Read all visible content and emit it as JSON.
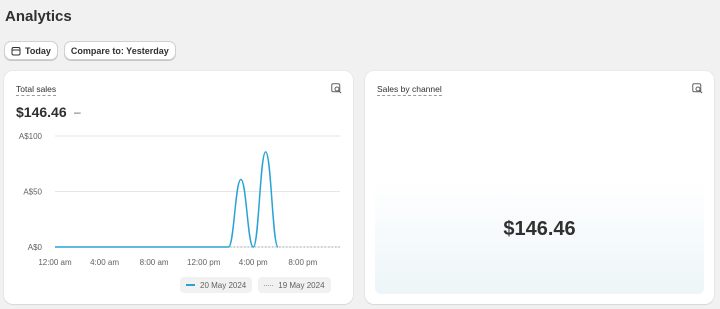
{
  "page": {
    "title": "Analytics"
  },
  "toolbar": {
    "date_button_label": "Today",
    "compare_button_label": "Compare to: Yesterday"
  },
  "total_sales_card": {
    "title": "Total sales",
    "value": "$146.46",
    "delta": "–",
    "legend": [
      "20 May 2024",
      "19 May 2024"
    ]
  },
  "sales_by_channel_card": {
    "title": "Sales by channel",
    "value": "$146.46"
  },
  "colors": {
    "current_series": "#29a3d4",
    "previous_series": "#9aa8b2"
  },
  "chart_data": {
    "type": "line",
    "title": "Total sales",
    "y_ticks": [
      "A$0",
      "A$50",
      "A$100"
    ],
    "y_tick_values": [
      0,
      50,
      100
    ],
    "ylim": [
      0,
      100
    ],
    "x_tick_labels": [
      "12:00 am",
      "4:00 am",
      "8:00 am",
      "12:00 pm",
      "4:00 pm",
      "8:00 pm"
    ],
    "xlim": [
      0,
      23
    ],
    "grid": true,
    "series": [
      {
        "name": "20 May 2024",
        "style": "solid",
        "x": [
          0,
          1,
          2,
          3,
          4,
          5,
          6,
          7,
          8,
          9,
          10,
          11,
          12,
          13,
          14,
          15,
          16,
          17,
          18,
          19,
          20,
          21,
          22,
          23
        ],
        "y": [
          0,
          0,
          0,
          0,
          0,
          0,
          0,
          0,
          0,
          0,
          0,
          0,
          0,
          0,
          0,
          60.77,
          0,
          85.69,
          0,
          0,
          0,
          0,
          0,
          0
        ]
      },
      {
        "name": "19 May 2024",
        "style": "dotted",
        "x": [
          0,
          1,
          2,
          3,
          4,
          5,
          6,
          7,
          8,
          9,
          10,
          11,
          12,
          13,
          14,
          15,
          16,
          17,
          18,
          19,
          20,
          21,
          22,
          23
        ],
        "y": [
          0,
          0,
          0,
          0,
          0,
          0,
          0,
          0,
          0,
          0,
          0,
          0,
          0,
          0,
          0,
          0,
          0,
          0,
          0,
          0,
          0,
          0,
          0,
          0
        ]
      }
    ]
  }
}
